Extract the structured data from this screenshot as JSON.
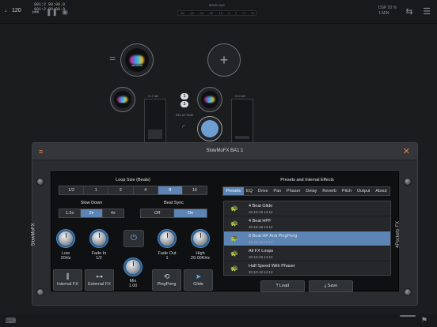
{
  "topbar": {
    "tempo_icon": "note-icon",
    "tempo": "120",
    "clock_line1": "001:2  00:00.0",
    "clock_line2": "001:2  00:00.0",
    "speaker_title": "SPKR OUT",
    "meter_ticks": [
      "-60",
      "-40",
      "-24",
      "-18",
      "-12",
      "-6",
      "0",
      "+3",
      "+6"
    ],
    "dsp": "DSP 20 %",
    "dsp_sub": "1 MIN"
  },
  "workspace": {
    "nodes": [
      {
        "label": "OBLIVION"
      },
      {
        "label": "LIMIT"
      },
      {
        "label": "MIX"
      },
      {
        "label": "1"
      },
      {
        "label": "2"
      }
    ],
    "fader_left_value": "+1.7 dB",
    "fader_right_value": "+0.0 dB",
    "delaytime_label": "DELAYTIME"
  },
  "panel": {
    "title": "SlowMoFX BA1:1",
    "side_left": "SlowMoFX",
    "side_right": "4Pockets FX",
    "loop_size": {
      "title": "Loop Size (Beats)",
      "options": [
        "1/2",
        "1",
        "2",
        "4",
        "8",
        "16"
      ],
      "selected": "8"
    },
    "slow_down": {
      "title": "Slow Down",
      "options": [
        "1.5x",
        "2x",
        "4x"
      ],
      "selected": "2x"
    },
    "beat_sync": {
      "title": "Beat Sync",
      "options": [
        "Off",
        "On"
      ],
      "selected": "On"
    },
    "knobs": {
      "low_label": "Low",
      "low_value": "20Hz",
      "fade_in_label": "Fade In",
      "fade_in_value": "1/2",
      "mix_label": "Mix",
      "mix_value": "1.00",
      "fade_out_label": "Fade Out",
      "fade_out_value": "1",
      "high_label": "High",
      "high_value": "20.00KHz"
    },
    "buttons": {
      "internal_fx": "Internal FX",
      "external_fx": "External FX",
      "pingpong": "PingPong",
      "glide": "Glide"
    },
    "presets": {
      "title": "Presets and Internal Effects",
      "tabs": [
        "Presets",
        "EQ",
        "Drive",
        "Pan",
        "Phaser",
        "Delay",
        "Reverb",
        "Pitch",
        "Output",
        "About"
      ],
      "active_tab": "Presets",
      "items": [
        {
          "name": "4 Beat Glide",
          "date": "20-10-19 14:12"
        },
        {
          "name": "4 Beat HPF",
          "date": "20-10-19 14:12"
        },
        {
          "name": "8 Beat HP And PingPong",
          "date": "20-10-19 14:12"
        },
        {
          "name": "All FX Loops",
          "date": "20-10-19 14:12"
        },
        {
          "name": "Half Speed With Phaser",
          "date": "20-10-19 14:12"
        }
      ],
      "selected_index": 2,
      "load_label": "Load",
      "save_label": "Save"
    }
  },
  "colors": {
    "accent": "#5c84b4",
    "close": "#e77d4c",
    "knob_ring": "#4a91d1"
  }
}
